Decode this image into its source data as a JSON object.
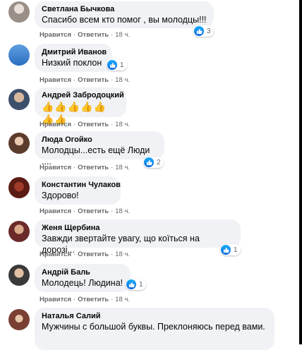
{
  "actions": {
    "like": "Нравится",
    "reply": "Ответить",
    "sep": "·",
    "time": "18 ч."
  },
  "comments": [
    {
      "author": "Светлана Бычкова",
      "text": "Спасибо всем кто помог , вы молодцы!!!",
      "reactions": "3"
    },
    {
      "author": "Дмитрий Иванов",
      "text": "Низкий поклон",
      "reactions": "1"
    },
    {
      "author": "Андрей Забродоцкий",
      "text": "👍👍👍👍👍👍👍",
      "reactions": ""
    },
    {
      "author": "Люда Огойко",
      "text": "Молодцы...есть ещё Люди ....",
      "reactions": "2"
    },
    {
      "author": "Константин Чулаков",
      "text": "Здорово!",
      "reactions": ""
    },
    {
      "author": "Женя Щербина",
      "text": "Завжди звертайте увагу, що коїться на дорозі...",
      "reactions": "1"
    },
    {
      "author": "Андрій Баль",
      "text": "Молодець! Людина!",
      "reactions": "1"
    },
    {
      "author": "Наталья Салий",
      "text": "Мужчины с большой буквы. Преклоняюсь перед вами.",
      "reactions": ""
    }
  ],
  "colors": {
    "bubble": "#f0f2f5",
    "meta": "#65676b",
    "like": "#1877f2"
  }
}
